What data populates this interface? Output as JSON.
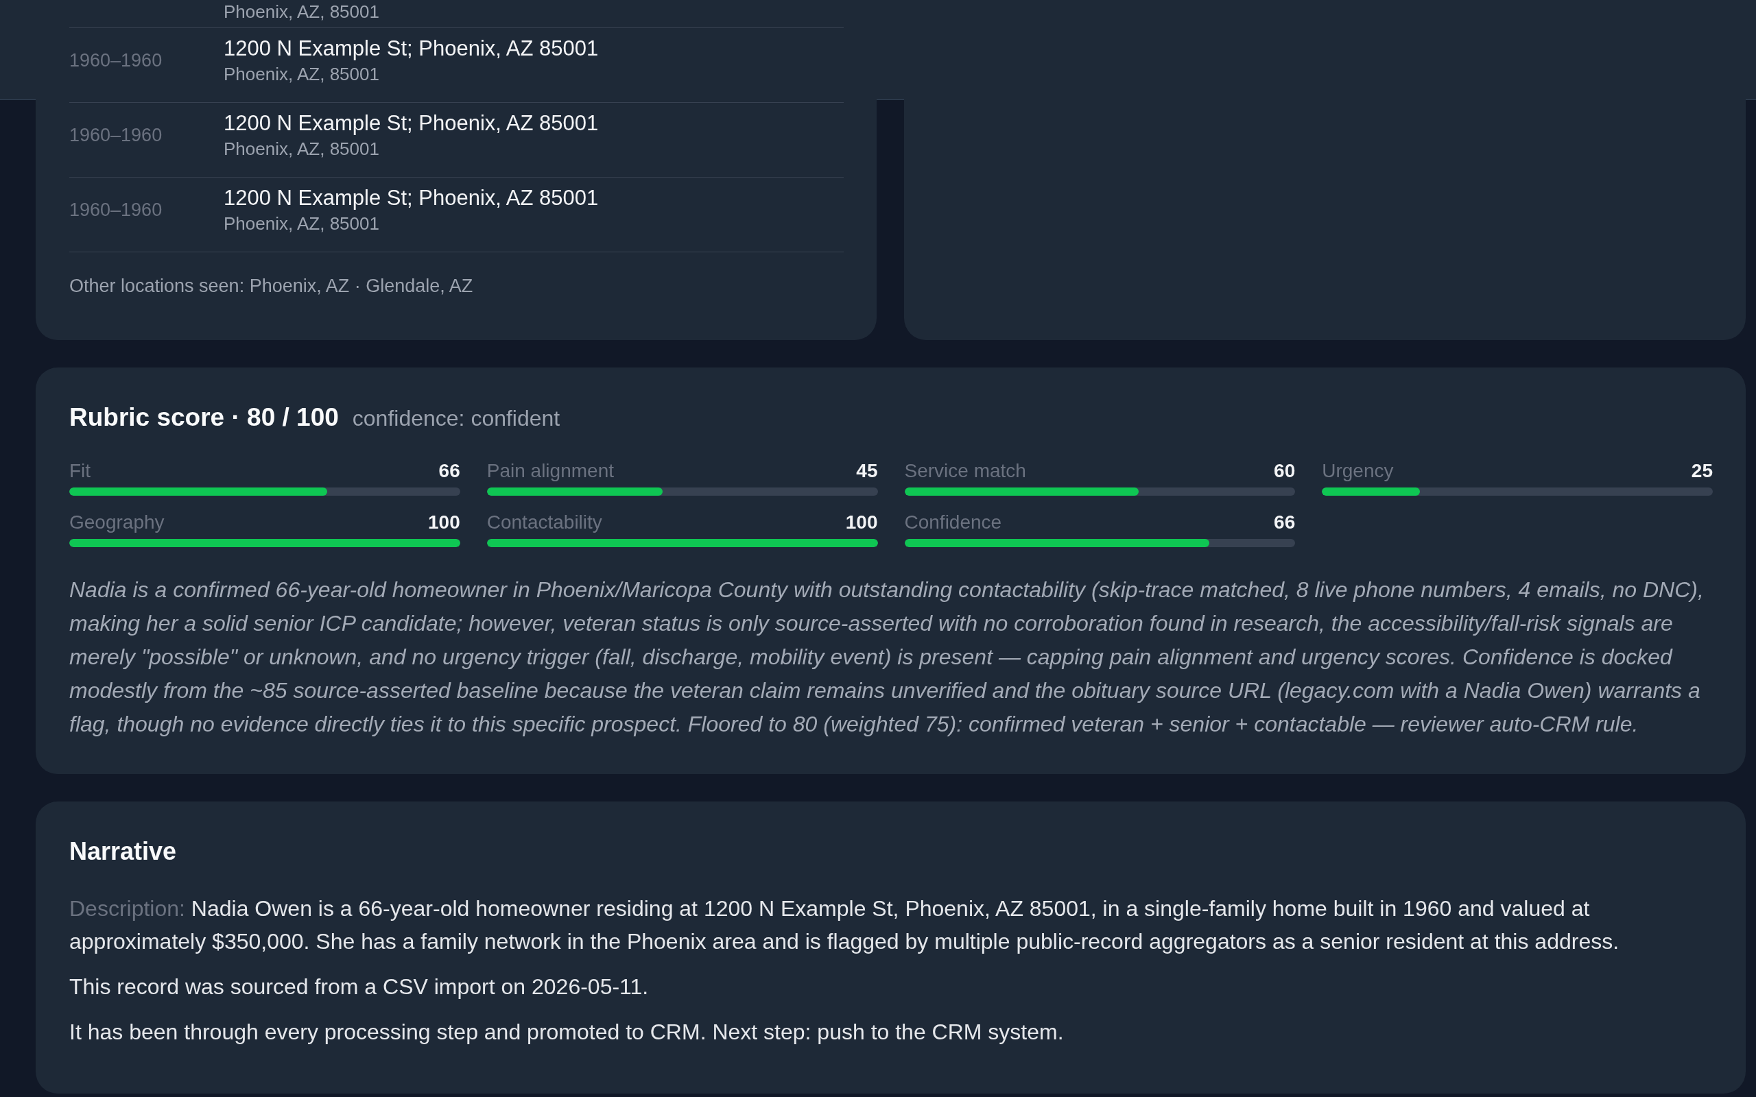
{
  "locations": {
    "rows": [
      {
        "sub": "Phoenix, AZ, 85001"
      },
      {
        "years": "1960–1960",
        "address": "1200 N Example St; Phoenix, AZ 85001",
        "sub": "Phoenix, AZ, 85001"
      },
      {
        "years": "1960–1960",
        "address": "1200 N Example St; Phoenix, AZ 85001",
        "sub": "Phoenix, AZ, 85001"
      },
      {
        "years": "1960–1960",
        "address": "1200 N Example St; Phoenix, AZ 85001",
        "sub": "Phoenix, AZ, 85001"
      }
    ],
    "other": "Other locations seen: Phoenix, AZ · Glendale, AZ"
  },
  "rubric": {
    "title": "Rubric score · 80 / 100",
    "confidence": "confidence: confident",
    "metrics": [
      {
        "label": "Fit",
        "value": "66",
        "level": 0.66
      },
      {
        "label": "Pain alignment",
        "value": "45",
        "level": 0.45
      },
      {
        "label": "Service match",
        "value": "60",
        "level": 0.6
      },
      {
        "label": "Urgency",
        "value": "25",
        "level": 0.25
      },
      {
        "label": "Geography",
        "value": "100",
        "level": 1
      },
      {
        "label": "Contactability",
        "value": "100",
        "level": 1
      },
      {
        "label": "Confidence",
        "value": "66",
        "level": 0.78
      }
    ],
    "rationale": "Nadia is a confirmed 66-year-old homeowner in Phoenix/Maricopa County with outstanding contactability (skip-trace matched, 8 live phone numbers, 4 emails, no DNC), making her a solid senior ICP candidate; however, veteran status is only source-asserted with no corroboration found in research, the accessibility/fall-risk signals are merely \"possible\" or unknown, and no urgency trigger (fall, discharge, mobility event) is present — capping pain alignment and urgency scores. Confidence is docked modestly from the ~85 source-asserted baseline because the veteran claim remains unverified and the obituary source URL (legacy.com with a Nadia Owen) warrants a flag, though no evidence directly ties it to this specific prospect. Floored to 80 (weighted 75): confirmed veteran + senior + contactable — reviewer auto-CRM rule."
  },
  "narrative": {
    "title": "Narrative",
    "paragraphs": [
      {
        "label": "Description:",
        "text": "Nadia Owen is a 66-year-old homeowner residing at 1200 N Example St, Phoenix, AZ 85001, in a single-family home built in 1960 and valued at approximately $350,000. She has a family network in the Phoenix area and is flagged by multiple public-record aggregators as a senior resident at this address."
      },
      {
        "text": "This record was sourced from a CSV import on 2026-05-11."
      },
      {
        "text": "It has been through every processing step and promoted to CRM. Next step: push to the CRM system."
      }
    ]
  }
}
